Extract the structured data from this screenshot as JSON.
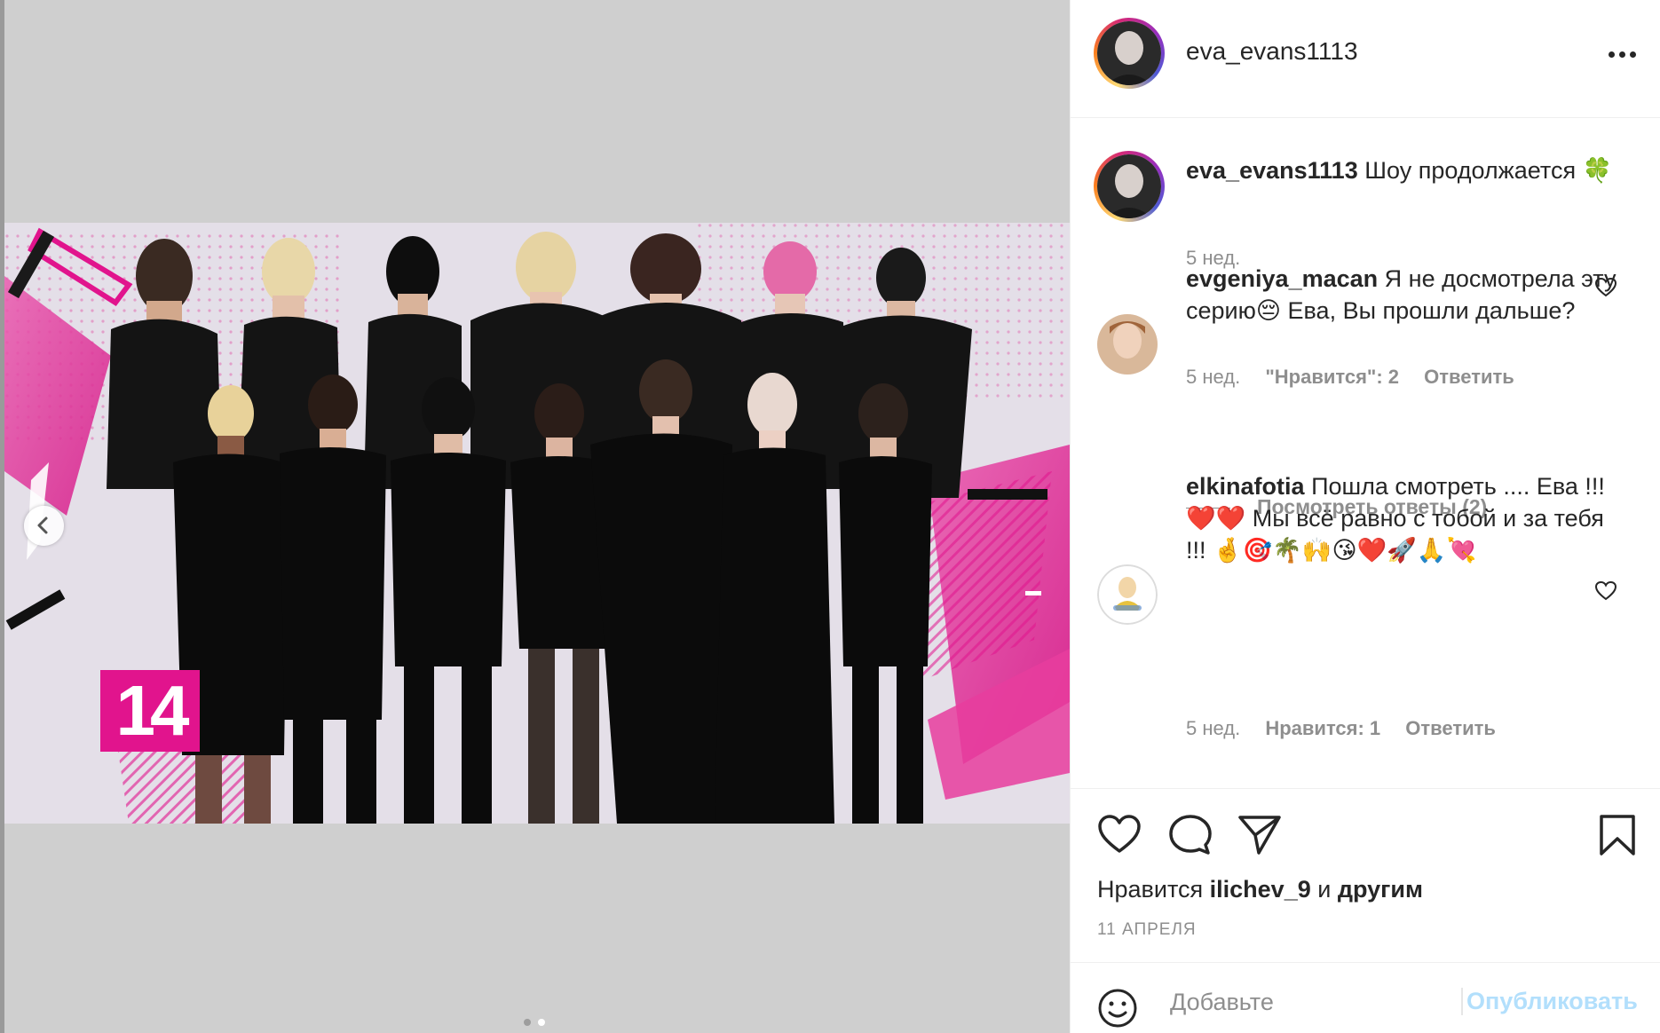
{
  "post": {
    "username": "eva_evans1113",
    "image": {
      "badge_number": "14",
      "slide_count": 2,
      "active_slide": 2
    }
  },
  "caption": {
    "username": "eva_evans1113",
    "text": "Шоу продолжается 🍀",
    "time": "5 нед."
  },
  "comments": [
    {
      "username": "evgeniya_macan",
      "text": "Я не досмотрела эту серию😔 Ева, Вы прошли дальше?",
      "time": "5 нед.",
      "likes": "\"Нравится\": 2",
      "reply": "Ответить",
      "view_replies": "Посмотреть ответы (2)"
    },
    {
      "username": "elkinafotia",
      "text": "Пошла смотреть .... Ева !!! ❤️❤️ Мы всё равно с тобой и за тебя !!! 🤞🎯🌴🙌😘❤️🚀🙏💘",
      "time": "5 нед.",
      "likes": "Нравится: 1",
      "reply": "Ответить"
    }
  ],
  "likes": {
    "prefix": "Нравится",
    "user": "ilichev_9",
    "middle": "и",
    "suffix": "другим"
  },
  "date": "11 АПРЕЛЯ",
  "add_comment": {
    "placeholder": "Добавьте",
    "publish_label": "Опубликовать"
  },
  "colors": {
    "brand_pink": "#e1148d",
    "publish_disabled": "#b2dffc",
    "meta_gray": "#8e8e8e"
  },
  "icons": [
    "more-icon",
    "heart-icon",
    "comment-icon",
    "share-icon",
    "bookmark-icon",
    "emoji-icon",
    "chevron-left-icon"
  ]
}
